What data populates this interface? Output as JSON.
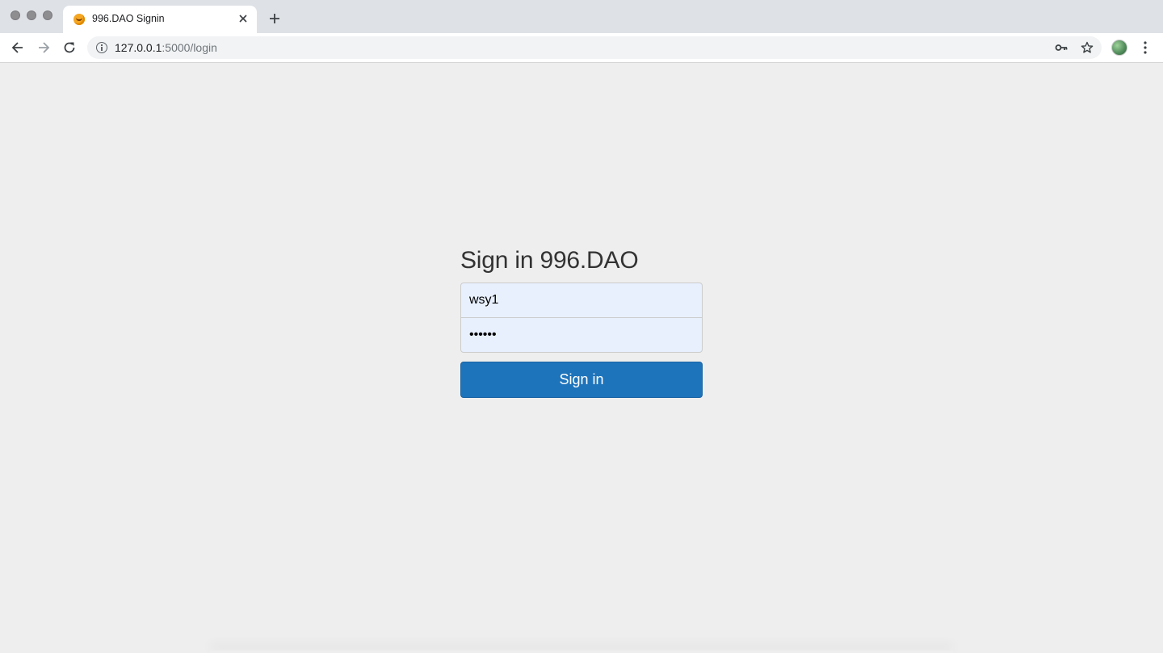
{
  "browser": {
    "tab": {
      "title": "996.DAO Signin",
      "favicon": "emoji-favicon-icon",
      "close_icon": "close-icon"
    },
    "new_tab_icon": "plus-icon",
    "address_bar": {
      "url_host": "127.0.0.1",
      "url_rest": ":5000/login",
      "site_info_icon": "info-icon"
    },
    "toolbar_icons": [
      "back-icon",
      "forward-icon",
      "reload-icon",
      "key-icon",
      "star-icon",
      "profile-avatar",
      "menu-dots-icon"
    ]
  },
  "login": {
    "heading": "Sign in 996.DAO",
    "username_value": "wsy1",
    "password_value": "••••••",
    "submit_label": "Sign in"
  },
  "colors": {
    "page_background": "#eeeeee",
    "input_background": "#e8f0fe",
    "primary_button": "#1e74bb"
  }
}
